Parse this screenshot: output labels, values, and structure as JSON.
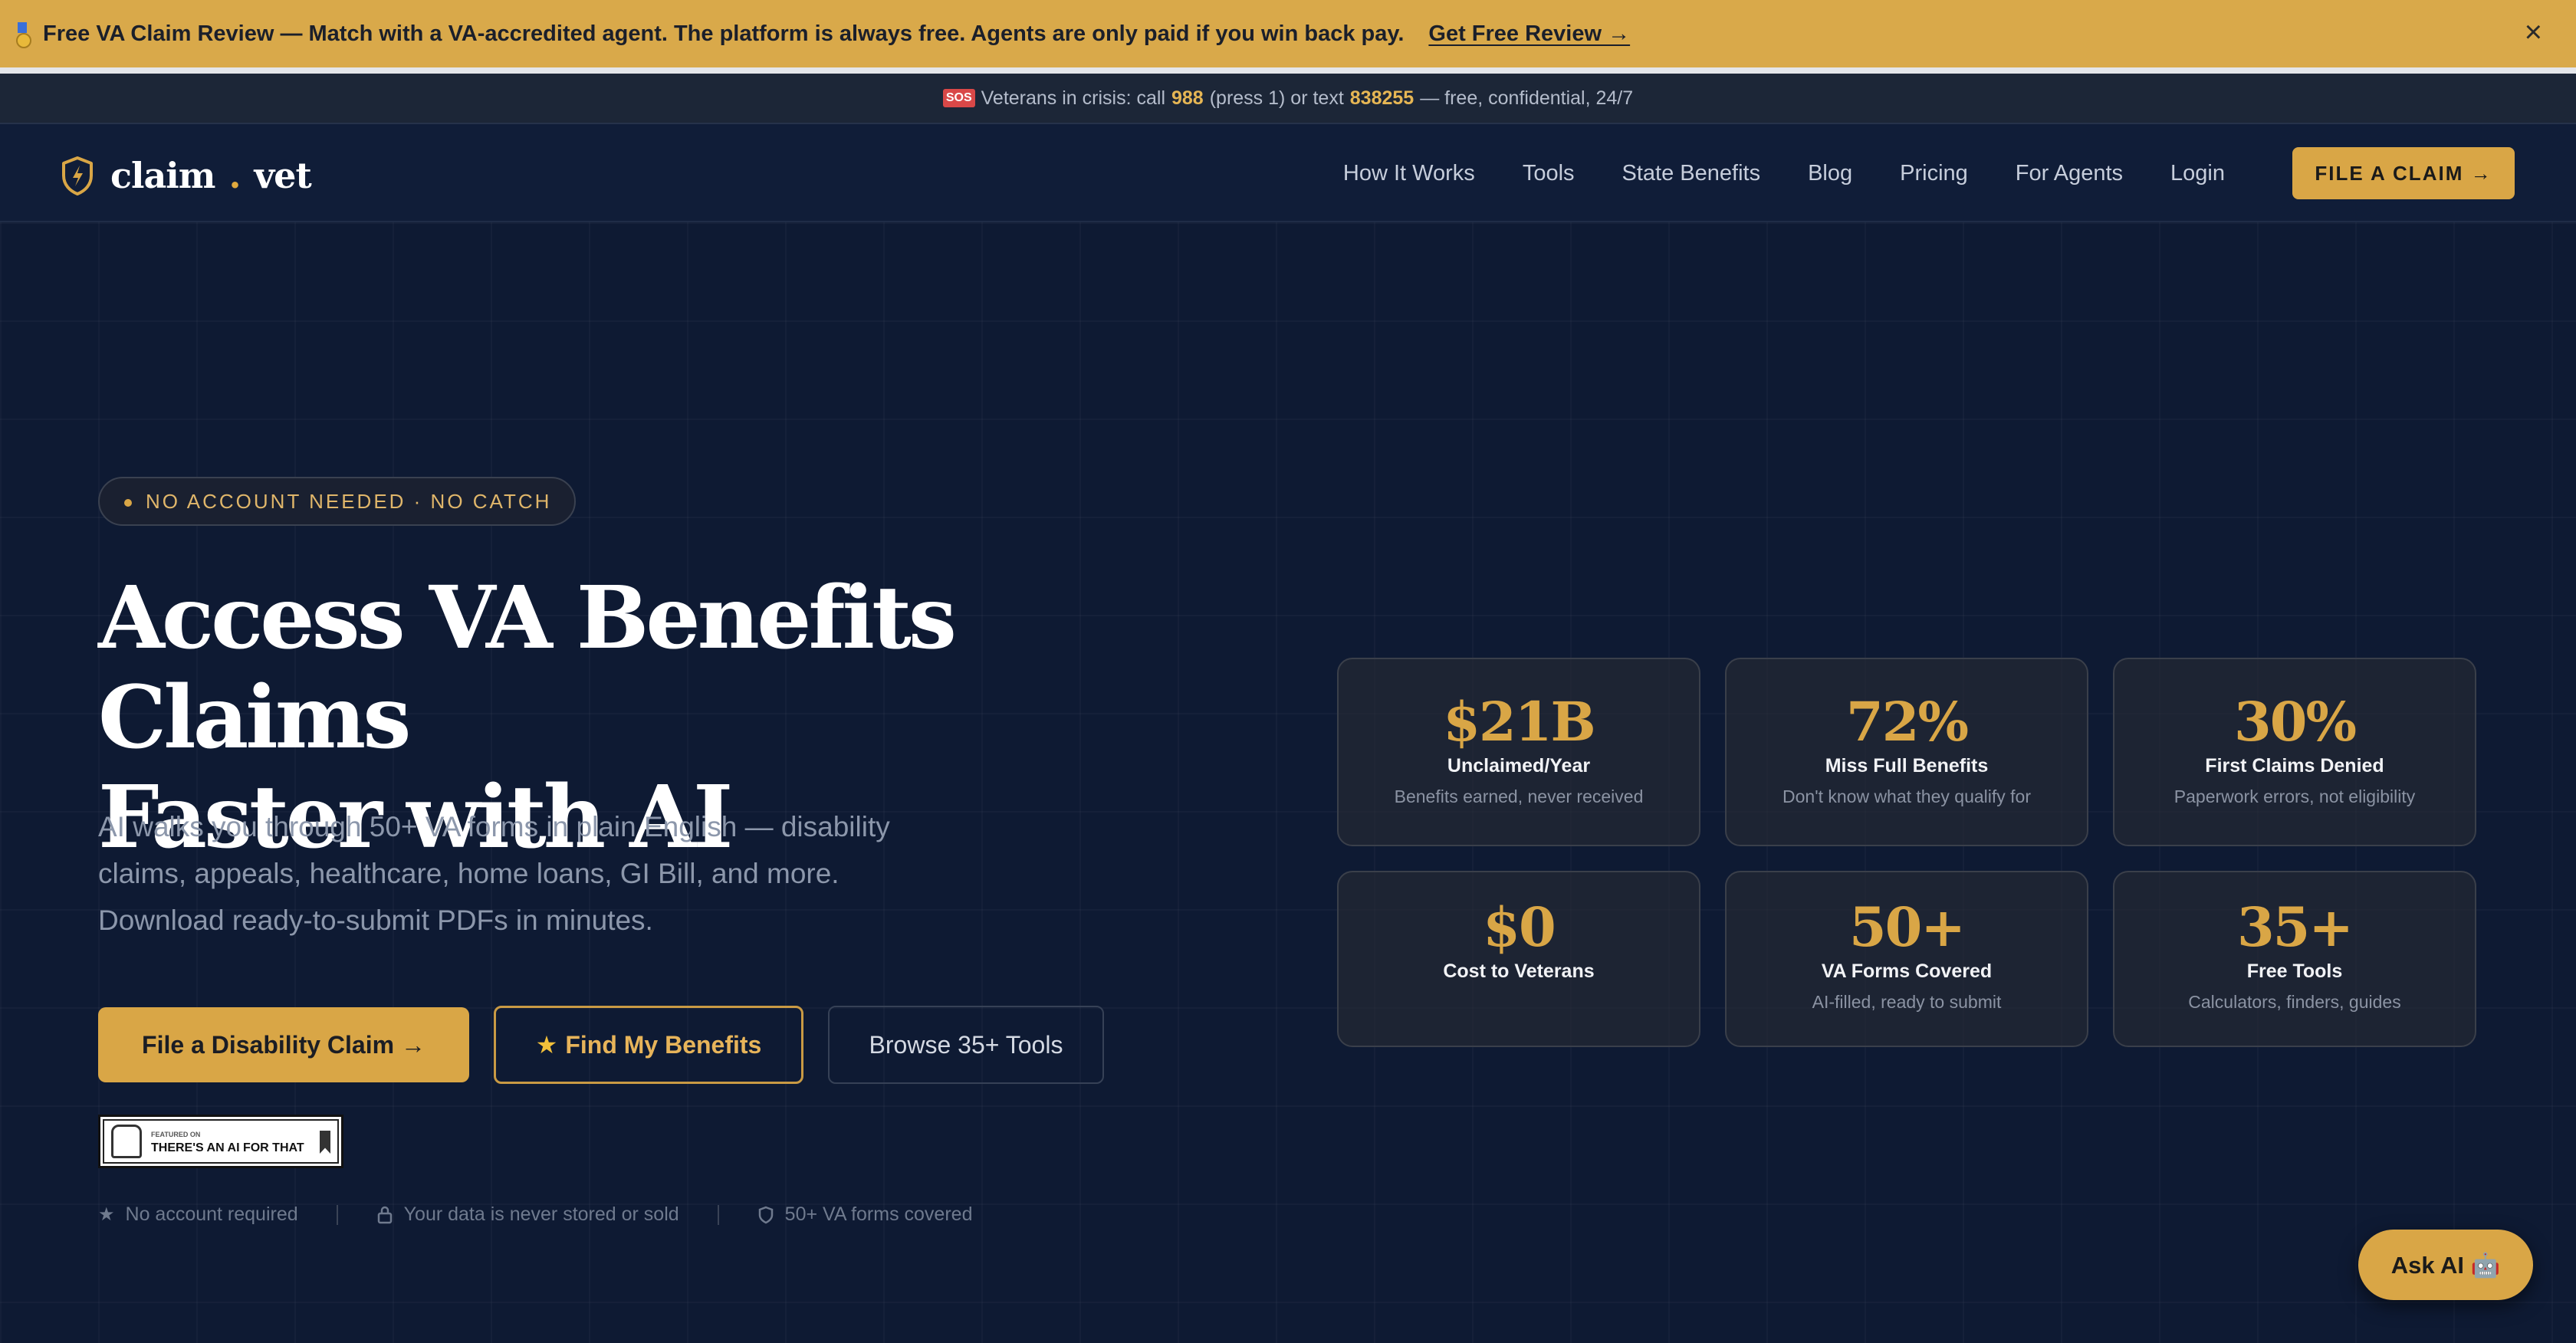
{
  "promo": {
    "text": "Free VA Claim Review — Match with a VA-accredited agent. The platform is always free. Agents are only paid if you win back pay.",
    "link": "Get Free Review →",
    "close": "×"
  },
  "crisis": {
    "prefix": "Veterans in crisis: call",
    "call_number": "988",
    "middle": "(press 1) or text",
    "text_number": "838255",
    "suffix": "— free, confidential, 24/7",
    "sos": "SOS"
  },
  "nav": {
    "logo_left": "claim",
    "logo_dot": ".",
    "logo_right": "vet",
    "links": [
      "How It Works",
      "Tools",
      "State Benefits",
      "Blog",
      "Pricing",
      "For Agents",
      "Login"
    ],
    "cta": "FILE A CLAIM →"
  },
  "hero": {
    "badge": "NO ACCOUNT NEEDED · NO CATCH",
    "headline_line1": "Access VA Benefits Claims",
    "headline_line2": "Faster with AI",
    "subtitle": "AI walks you through 50+ VA forms in plain English — disability claims, appeals, healthcare, home loans, GI Bill, and more. Download ready-to-submit PDFs in minutes.",
    "buttons": {
      "primary": "File a Disability Claim →",
      "benefits": "Find My Benefits",
      "tools": "Browse 35+ Tools"
    },
    "featured": {
      "small": "FEATURED ON",
      "name": "THERE'S AN AI FOR THAT"
    },
    "trust": [
      "No account required",
      "Your data is never stored or sold",
      "50+ VA forms covered"
    ]
  },
  "stats": [
    {
      "value": "$21B",
      "label": "Unclaimed/Year",
      "note": "Benefits earned, never received"
    },
    {
      "value": "72%",
      "label": "Miss Full Benefits",
      "note": "Don't know what they qualify for"
    },
    {
      "value": "30%",
      "label": "First Claims Denied",
      "note": "Paperwork errors, not eligibility"
    },
    {
      "value": "$0",
      "label": "Cost to Veterans",
      "note": ""
    },
    {
      "value": "50+",
      "label": "VA Forms Covered",
      "note": "AI-filled, ready to submit"
    },
    {
      "value": "35+",
      "label": "Free Tools",
      "note": "Calculators, finders, guides"
    }
  ],
  "ask_ai": "Ask AI 🤖",
  "colors": {
    "accent": "#d9a646",
    "background": "#0e1a33",
    "banner": "#d9a94a"
  },
  "icons": {
    "promo": "medal-icon",
    "logo": "shield-bolt-icon",
    "trust": [
      "star-icon",
      "lock-icon",
      "shield-icon"
    ]
  }
}
